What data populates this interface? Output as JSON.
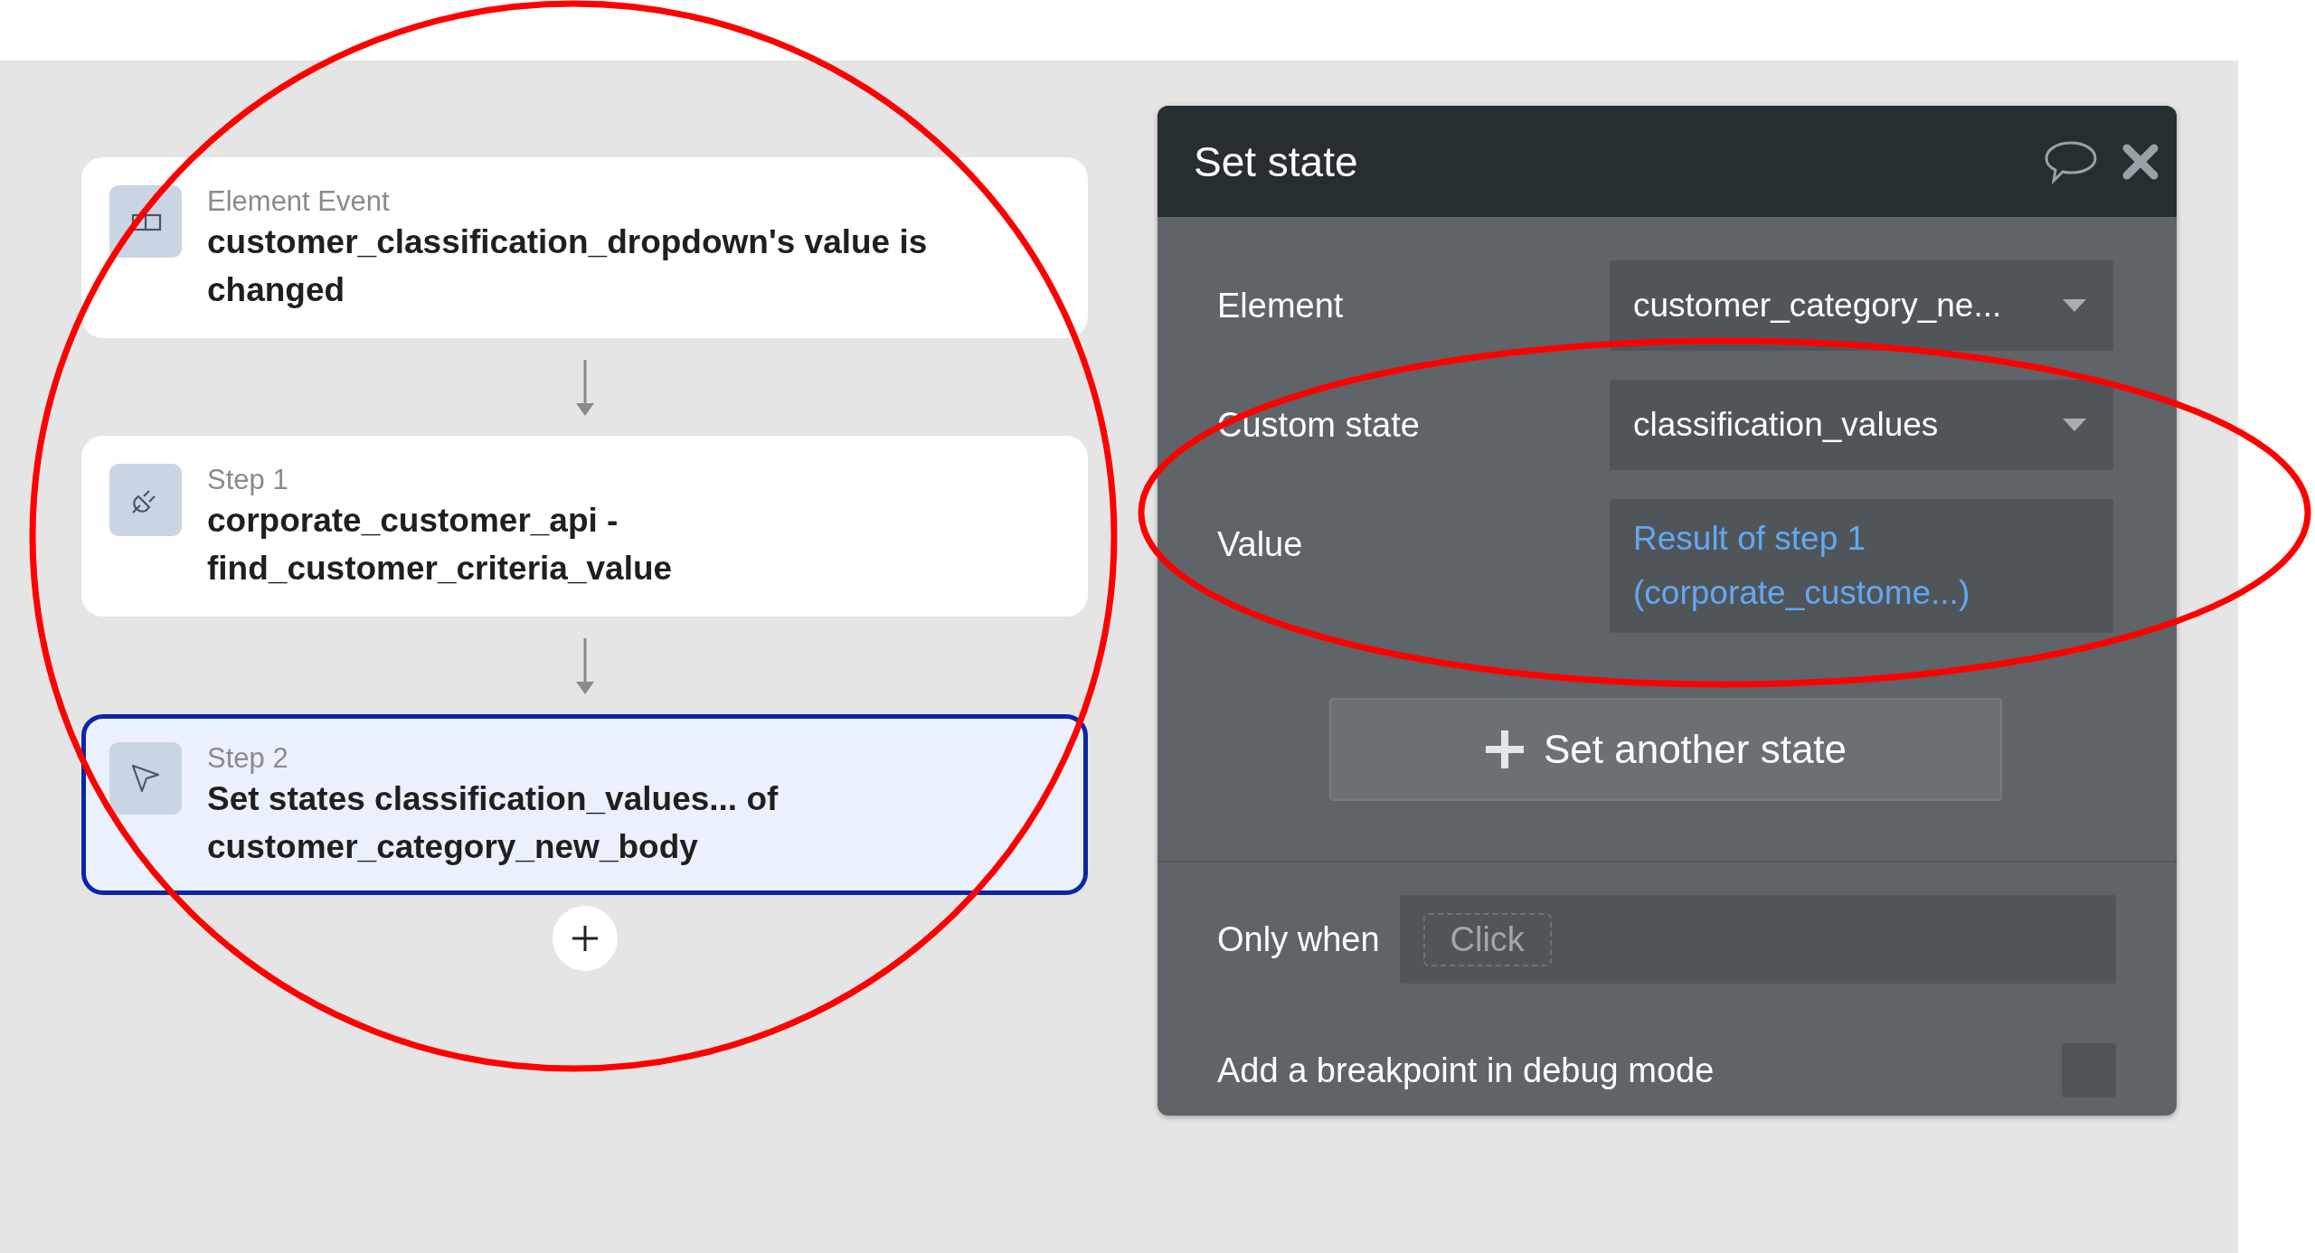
{
  "workflow": {
    "steps": [
      {
        "kind": "event",
        "label": "Element Event",
        "title": "customer_classification_dropdown's value is changed",
        "selected": false
      },
      {
        "kind": "api",
        "label": "Step 1",
        "title": "corporate_customer_api - find_customer_criteria_value",
        "selected": false
      },
      {
        "kind": "set_state",
        "label": "Step 2",
        "title": "Set states classification_values... of customer_category_new_body",
        "selected": true
      }
    ]
  },
  "panel": {
    "title": "Set state",
    "fields": [
      {
        "label": "Element",
        "kind": "dropdown",
        "value": "customer_category_ne..."
      },
      {
        "label": "Custom state",
        "kind": "dropdown",
        "value": "classification_values"
      },
      {
        "label": "Value",
        "kind": "expression",
        "value": "Result of step 1 (corporate_custome...)"
      }
    ],
    "add_button": "Set another state",
    "condition": {
      "label": "Only when",
      "placeholder": "Click"
    },
    "breakpoint": {
      "label": "Add a breakpoint in debug mode",
      "checked": false
    }
  },
  "annotations": [
    {
      "kind": "ellipse",
      "color": "#ff0000"
    },
    {
      "kind": "ellipse",
      "color": "#ff0000"
    }
  ]
}
